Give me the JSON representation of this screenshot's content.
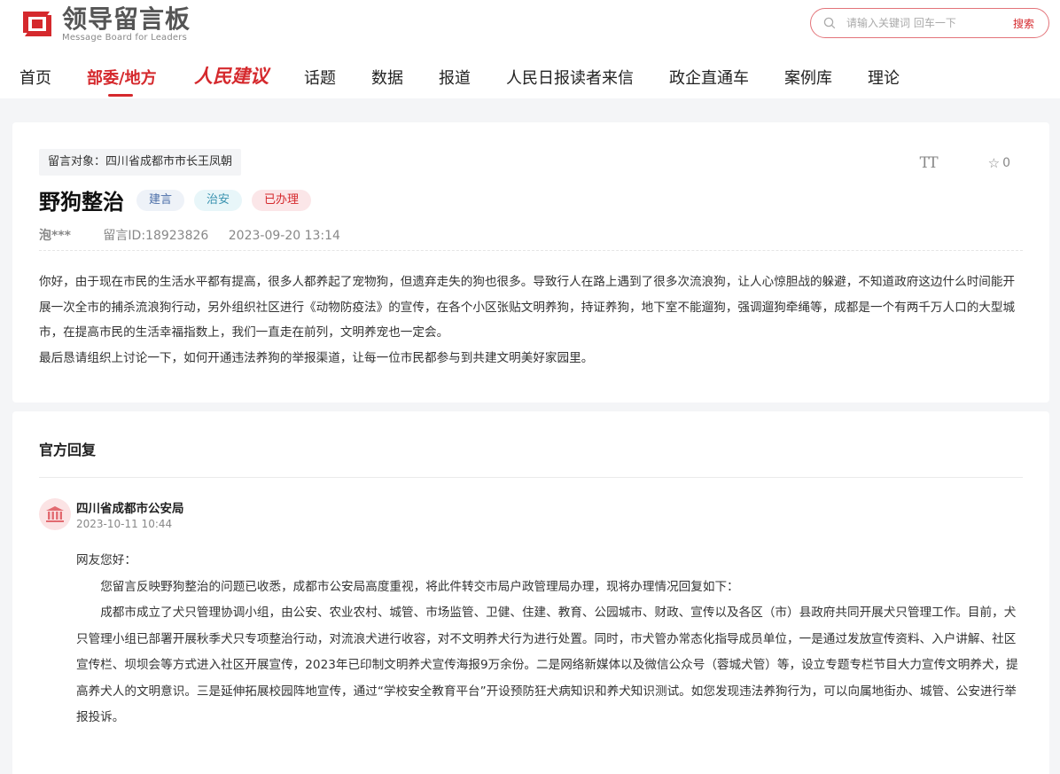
{
  "header": {
    "logo_title": "领导留言板",
    "logo_sub": "Message Board for Leaders",
    "search_placeholder": "请输入关键词 回车一下",
    "search_button": "搜索"
  },
  "nav": {
    "items": [
      "首页",
      "部委/地方",
      "人民建议",
      "话题",
      "数据",
      "报道",
      "人民日报读者来信",
      "政企直通车",
      "案例库",
      "理论"
    ],
    "active_index": 1
  },
  "message": {
    "target": "留言对象：四川省成都市市长王凤朝",
    "font_tool": "TT",
    "star_count": "0",
    "title": "野狗整治",
    "tags": [
      "建言",
      "治安",
      "已办理"
    ],
    "author": "泡***",
    "id": "留言ID:18923826",
    "date": "2023-09-20 13:14",
    "paragraphs": [
      "你好，由于现在市民的生活水平都有提高，很多人都养起了宠物狗，但遗弃走失的狗也很多。导致行人在路上遇到了很多次流浪狗，让人心惊胆战的躲避，不知道政府这边什么时间能开展一次全市的捕杀流浪狗行动，另外组织社区进行《动物防疫法》的宣传，在各个小区张贴文明养狗，持证养狗，地下室不能遛狗，强调遛狗牵绳等，成都是一个有两千万人口的大型城市，在提高市民的生活幸福指数上，我们一直走在前列，文明养宠也一定会。",
      "最后恳请组织上讨论一下，如何开通违法养狗的举报渠道，让每一位市民都参与到共建文明美好家园里。"
    ]
  },
  "reply": {
    "heading": "官方回复",
    "department": "四川省成都市公安局",
    "time": "2023-10-11 10:44",
    "greeting": "网友您好：",
    "paragraphs": [
      "您留言反映野狗整治的问题已收悉，成都市公安局高度重视，将此件转交市局户政管理局办理，现将办理情况回复如下：",
      "成都市成立了犬只管理协调小组，由公安、农业农村、城管、市场监管、卫健、住建、教育、公园城市、财政、宣传以及各区（市）县政府共同开展犬只管理工作。目前，犬只管理小组已部署开展秋季犬只专项整治行动，对流浪犬进行收容，对不文明养犬行为进行处置。同时，市犬管办常态化指导成员单位，一是通过发放宣传资料、入户讲解、社区宣传栏、坝坝会等方式进入社区开展宣传，2023年已印制文明养犬宣传海报9万余份。二是网络新媒体以及微信公众号（蓉城犬管）等，设立专题专栏节目大力宣传文明养犬，提高养犬人的文明意识。三是延伸拓展校园阵地宣传，通过“学校安全教育平台”开设预防狂犬病知识和养犬知识测试。如您发现违法养狗行为，可以向属地街办、城管、公安进行举报投诉。"
    ]
  },
  "colors": {
    "brand_red": "#d5292d",
    "page_bg": "#f4f5f7"
  }
}
